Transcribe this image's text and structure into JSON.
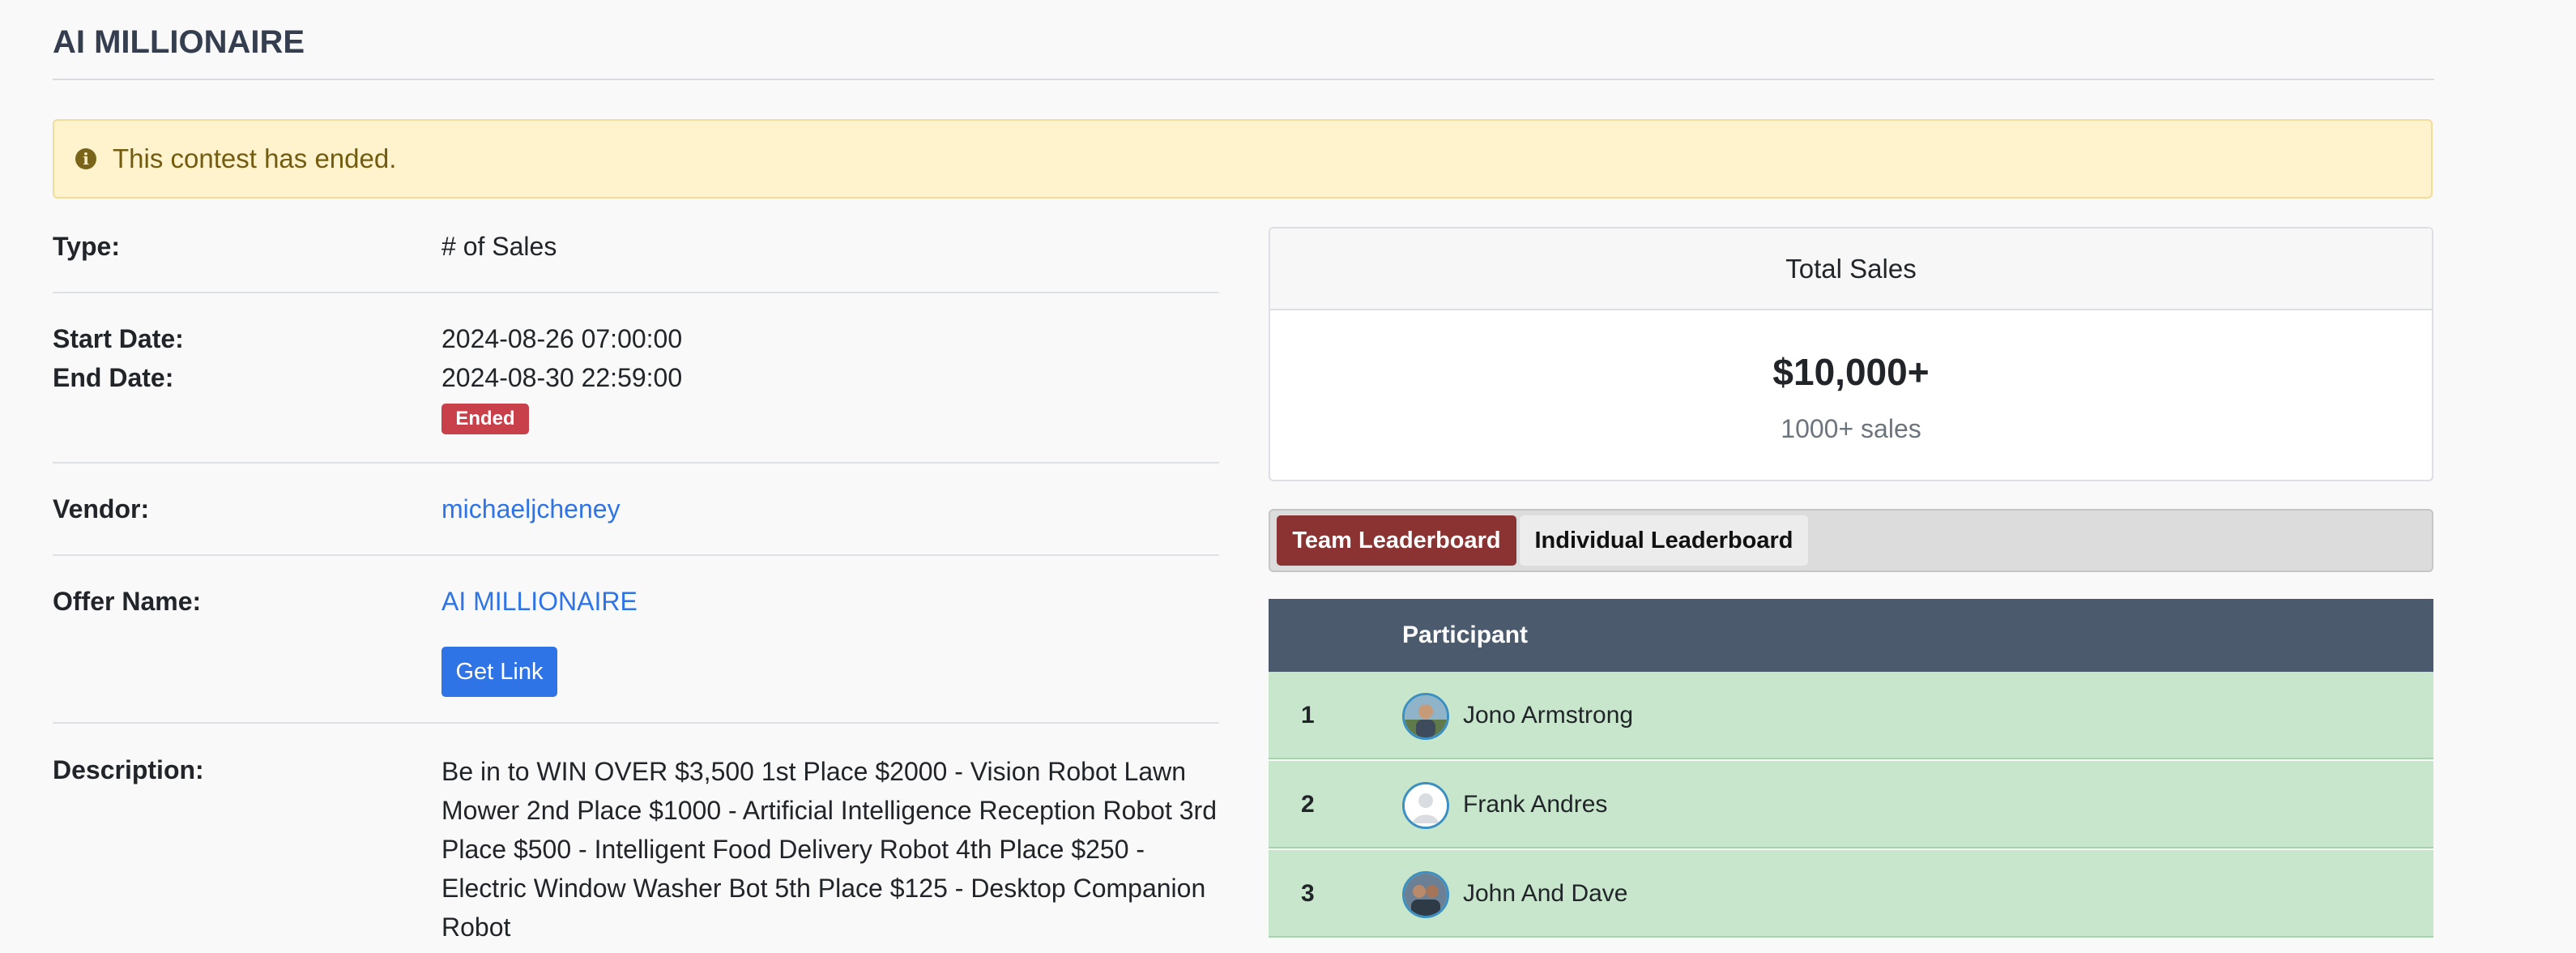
{
  "page": {
    "title": "AI MILLIONAIRE"
  },
  "alert": {
    "icon": "info-icon",
    "text": "This contest has ended."
  },
  "details": {
    "type_label": "Type:",
    "type_value": "# of Sales",
    "start_label": "Start Date:",
    "start_value": "2024-08-26 07:00:00",
    "end_label": "End Date:",
    "end_value": "2024-08-30 22:59:00",
    "status_badge": "Ended",
    "vendor_label": "Vendor:",
    "vendor_value": "michaeljcheney",
    "offer_label": "Offer Name:",
    "offer_value": "AI MILLIONAIRE",
    "get_link_label": "Get Link",
    "description_label": "Description:",
    "description_value": "Be in to WIN OVER $3,500 1st Place $2000 - Vision Robot Lawn Mower 2nd Place $1000 - Artificial Intelligence Reception Robot 3rd Place $500 - Intelligent Food Delivery Robot 4th Place $250 - Electric Window Washer Bot 5th Place $125 - Desktop Companion Robot"
  },
  "sales": {
    "header": "Total Sales",
    "amount": "$10,000+",
    "count": "1000+ sales"
  },
  "tabs": [
    {
      "label": "Team Leaderboard",
      "active": true
    },
    {
      "label": "Individual Leaderboard",
      "active": false
    }
  ],
  "leaderboard": {
    "column_rank": "",
    "column_participant": "Participant",
    "rows": [
      {
        "rank": "1",
        "name": "Jono Armstrong",
        "avatar": "photo-avatar"
      },
      {
        "rank": "2",
        "name": "Frank Andres",
        "avatar": "default-avatar"
      },
      {
        "rank": "3",
        "name": "John And Dave",
        "avatar": "photo-avatar"
      }
    ]
  },
  "colors": {
    "link": "#2f74e6",
    "badge_ended": "#c8404a",
    "active_tab": "#8b3232",
    "table_header": "#4b5a6d",
    "row_highlight": "#c8e6cb",
    "alert_bg": "#fff3cd"
  }
}
